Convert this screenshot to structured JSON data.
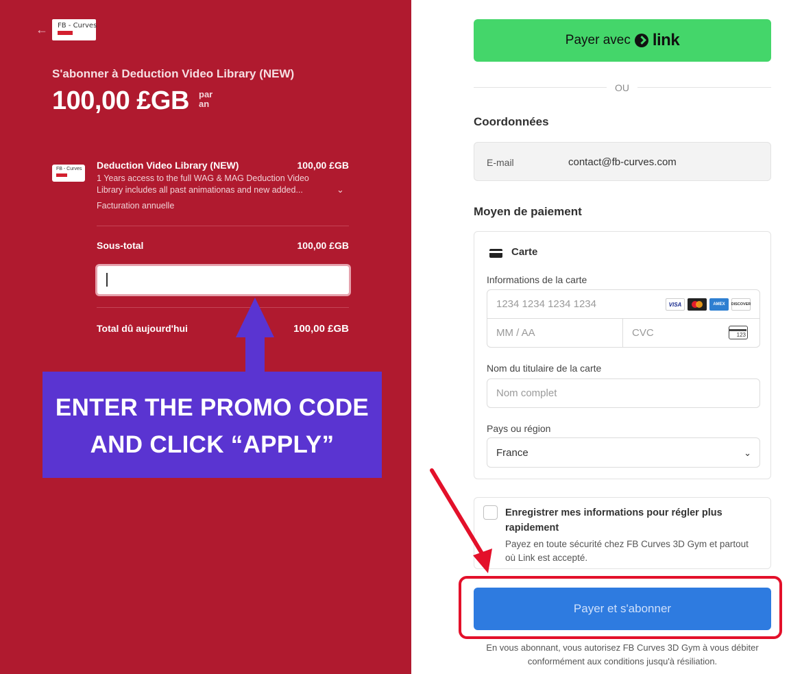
{
  "left": {
    "logo_text": "FB - Curves",
    "subscribe_title": "S'abonner à Deduction Video Library (NEW)",
    "price": "100,00 £GB",
    "period_line1": "par",
    "period_line2": "an",
    "product": {
      "thumb_text": "FB - Curves",
      "name": "Deduction Video Library (NEW)",
      "price": "100,00 £GB",
      "description": "1 Years access to the full WAG & MAG Deduction Video Library includes all past animationas and new added...",
      "billing": "Facturation annuelle"
    },
    "subtotal_label": "Sous-total",
    "subtotal_value": "100,00 £GB",
    "promo_value": "",
    "total_label": "Total dû aujourd'hui",
    "total_value": "100,00 £GB",
    "callout_line1": "ENTER THE PROMO CODE",
    "callout_line2": "AND CLICK “APPLY”"
  },
  "right": {
    "link_button_prefix": "Payer avec",
    "link_button_word": "link",
    "or_text": "OU",
    "contact_title": "Coordonnées",
    "email_label": "E-mail",
    "email_value": "contact@fb-curves.com",
    "payment_title": "Moyen de paiement",
    "card_tab_label": "Carte",
    "card_info_label": "Informations de la carte",
    "card_number_placeholder": "1234 1234 1234 1234",
    "expiry_placeholder": "MM / AA",
    "cvc_placeholder": "CVC",
    "cvc_icon_text": "123",
    "brands": [
      "VISA",
      "",
      "AMEX",
      "DISCOVER"
    ],
    "holder_label": "Nom du titulaire de la carte",
    "holder_placeholder": "Nom complet",
    "country_label": "Pays ou région",
    "country_value": "France",
    "save_title": "Enregistrer mes informations pour régler plus rapidement",
    "save_desc": "Payez en toute sécurité chez FB Curves 3D Gym et partout où Link est accepté.",
    "submit_label": "Payer et s'abonner",
    "legal": "En vous abonnant, vous autorisez FB Curves 3D Gym à vous débiter conformément aux conditions jusqu'à résiliation."
  },
  "colors": {
    "left_bg": "#b01a2f",
    "callout_bg": "#5a34d1",
    "link_green": "#44d66a",
    "submit_blue": "#2e7be0",
    "highlight_red": "#e3102a"
  }
}
